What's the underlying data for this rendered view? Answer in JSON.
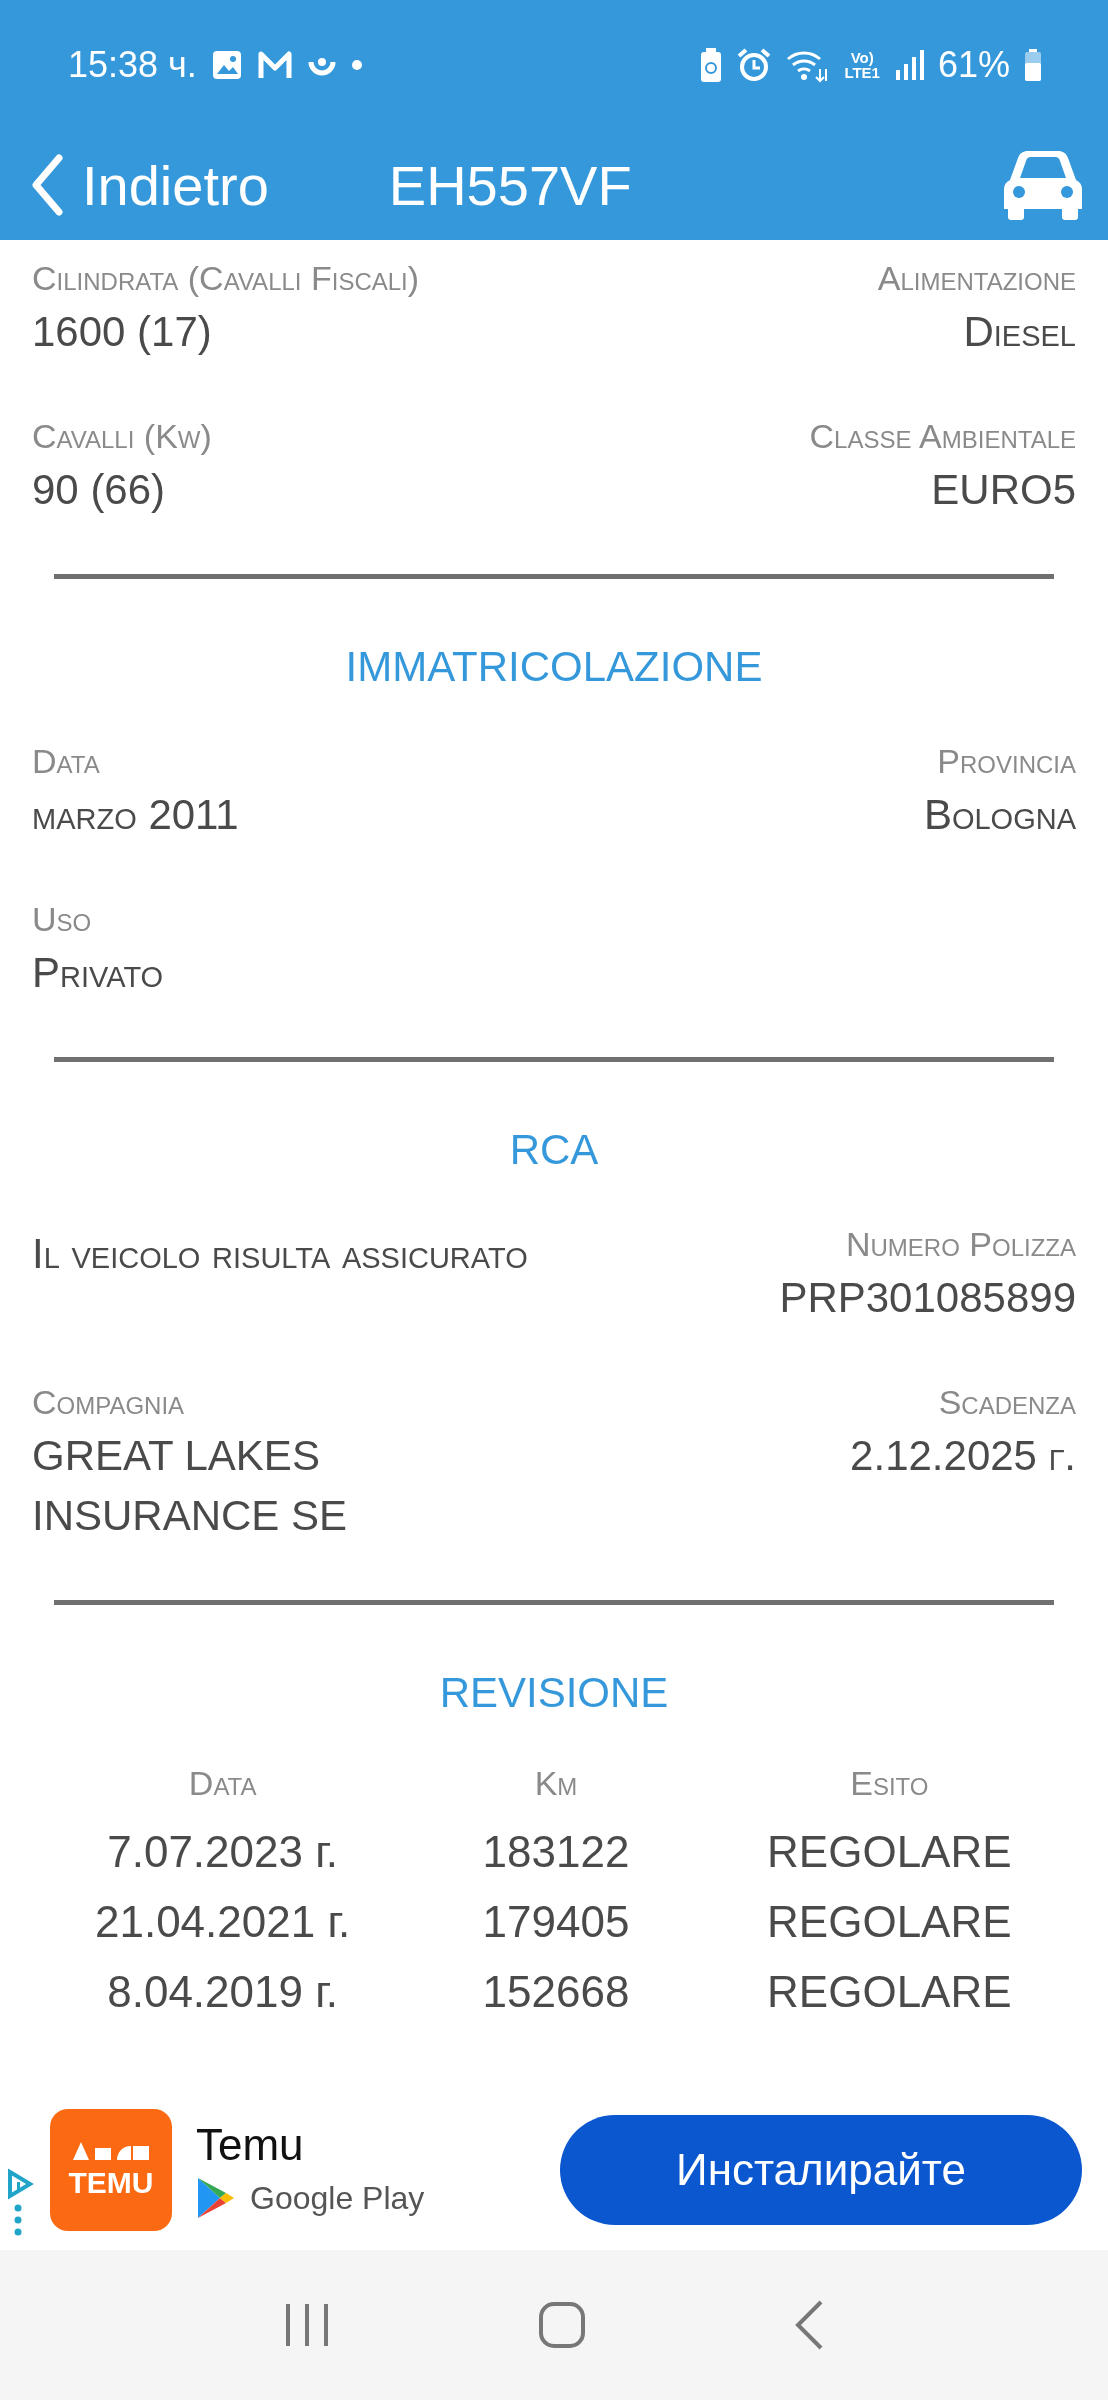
{
  "status_bar": {
    "time": "15:38 ч.",
    "volte": [
      "Vo)",
      "LTE1"
    ],
    "battery": "61%"
  },
  "app_bar": {
    "back": "Indietro",
    "title": "EH557VF"
  },
  "sections": [
    {
      "fields": [
        {
          "label": "Cilindrata (Cavalli Fiscali)",
          "value": "1600 (17)"
        },
        {
          "label": "Alimentazione",
          "value": "Diesel"
        },
        {
          "label": "Cavalli (Kw)",
          "value": "90 (66)"
        },
        {
          "label": "Classe Ambientale",
          "value": "EURO5"
        }
      ]
    },
    {
      "title": "IMMATRICOLAZIONE",
      "fields": [
        {
          "label": "Data",
          "value": "marzo 2011"
        },
        {
          "label": "Provincia",
          "value": "Bologna"
        },
        {
          "label": "Uso",
          "value": "Privato"
        }
      ]
    },
    {
      "title": "RCA",
      "fields": [
        {
          "value": "Il veicolo risulta assicurato"
        },
        {
          "label": "Numero Polizza",
          "value": "PRP301085899"
        },
        {
          "label": "Compagnia",
          "value": "GREAT LAKES INSURANCE SE"
        },
        {
          "label": "Scadenza",
          "value": "2.12.2025 г."
        }
      ]
    }
  ],
  "revisione": {
    "title": "REVISIONE",
    "columns": [
      "Data",
      "Km",
      "Esito"
    ],
    "rows": [
      [
        "7.07.2023 г.",
        "183122",
        "REGOLARE"
      ],
      [
        "21.04.2021 г.",
        "179405",
        "REGOLARE"
      ],
      [
        "8.04.2019 г.",
        "152668",
        "REGOLARE"
      ]
    ]
  },
  "ad": {
    "logo": "TEMU",
    "name": "Temu",
    "store": "Google Play",
    "button": "Инсталирайте"
  }
}
